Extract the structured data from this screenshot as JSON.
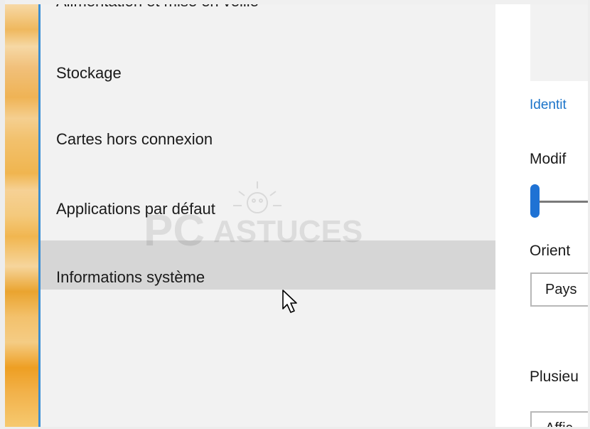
{
  "sidebar": {
    "items": [
      {
        "label": "Alimentation et mise en veille"
      },
      {
        "label": "Stockage"
      },
      {
        "label": "Cartes hors connexion"
      },
      {
        "label": "Applications par défaut"
      },
      {
        "label": "Informations système",
        "selected": true
      }
    ]
  },
  "watermark": {
    "brand_left": "PC",
    "brand_right": "ASTUCES"
  },
  "content": {
    "link_text": "Identit",
    "scale_label": "Modif",
    "orientation_label": "Orient",
    "orientation_value": "Pays",
    "multiple_label": "Plusieu",
    "multiple_value": "Affic"
  },
  "colors": {
    "accent": "#1f72d4",
    "link": "#1a73c9",
    "selected_bg": "#d6d6d6",
    "nav_bg": "#f2f2f2"
  }
}
